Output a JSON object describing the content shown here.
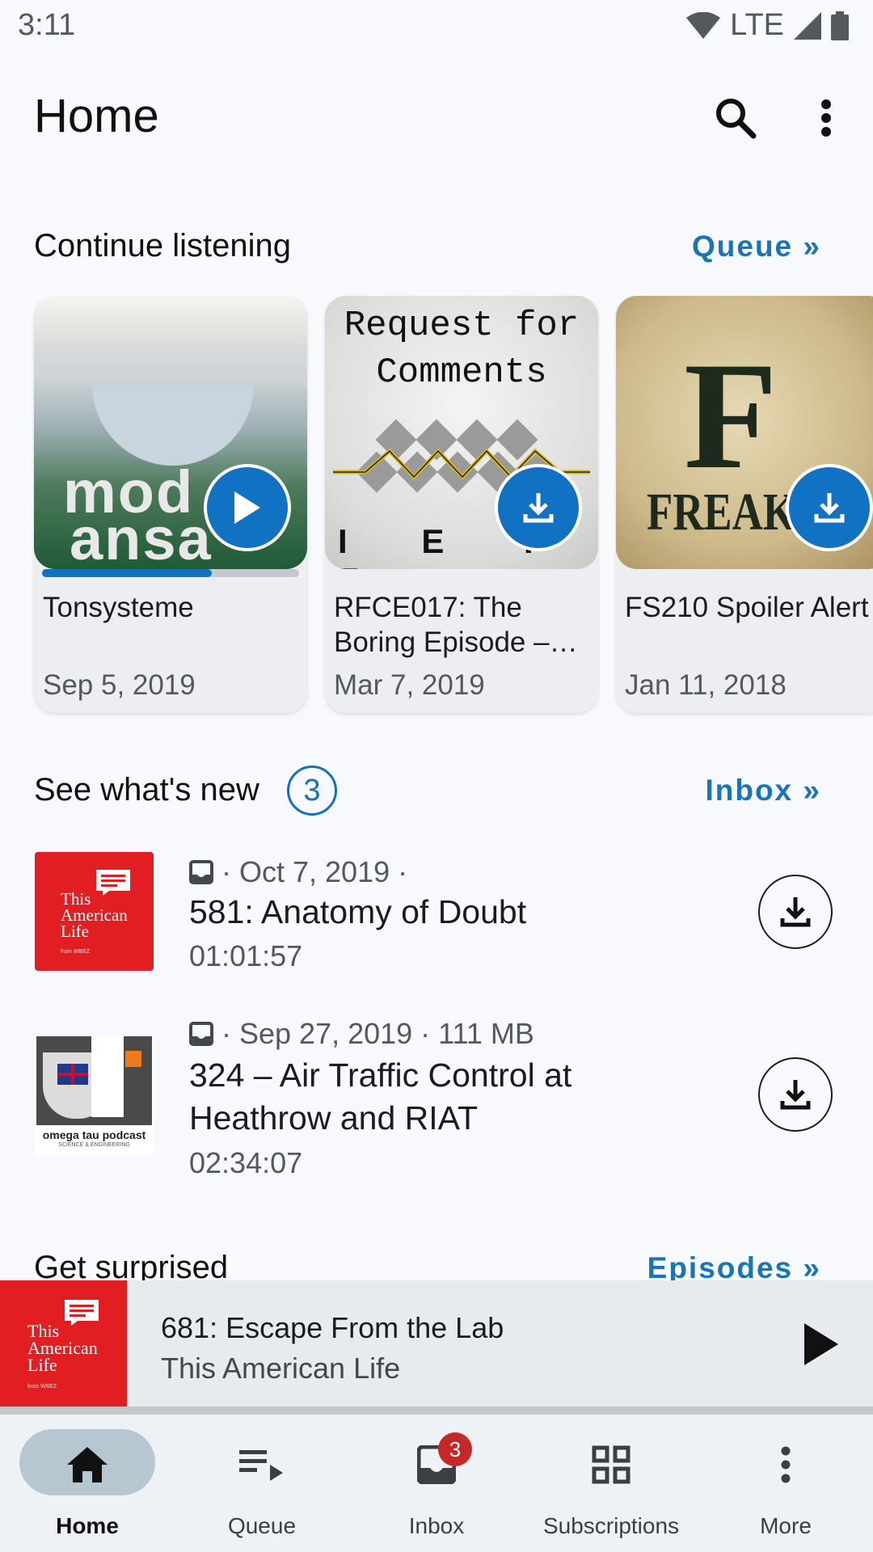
{
  "status_bar": {
    "time": "3:11",
    "network": "LTE"
  },
  "app_bar": {
    "title": "Home",
    "icons": [
      "search-icon",
      "more-vert-icon"
    ]
  },
  "continue_listening": {
    "title": "Continue listening",
    "link": "Queue »",
    "cards": [
      {
        "art_text_1": "mod",
        "art_text_2": "ansa",
        "title": "Tonsysteme",
        "date": "Sep 5, 2019",
        "action": "play-icon",
        "progress": 0.66
      },
      {
        "art_text_1": "Request for",
        "art_text_2": "Comments",
        "art_text_3": "I E T F",
        "title": "RFCE017: The Boring Episode –…",
        "date": "Mar 7, 2019",
        "action": "download-icon"
      },
      {
        "art_text_1": "F",
        "art_text_2": "FREAKS",
        "title": "FS210 Spoiler Alert",
        "date": "Jan 11, 2018",
        "action": "download-icon"
      }
    ]
  },
  "whats_new": {
    "title": "See what's new",
    "count": "3",
    "link": "Inbox »",
    "episodes": [
      {
        "logo_text": "This American Life",
        "logo_sub": "from WBEZ",
        "meta": "· Oct 7, 2019 ·",
        "title": "581: Anatomy of Doubt",
        "duration": "01:01:57"
      },
      {
        "logo_text": "omega tau podcast",
        "logo_sub": "SCIENCE & ENGINEERING",
        "meta": "· Sep 27, 2019 · 111 MB",
        "title": "324 – Air Traffic Control at Heathrow and RIAT",
        "duration": "02:34:07"
      }
    ]
  },
  "get_surprised": {
    "title": "Get surprised",
    "link": "Episodes »"
  },
  "mini_player": {
    "title": "681: Escape From the Lab",
    "podcast": "This American Life",
    "logo_text": "This American Life",
    "logo_sub": "from WBEZ"
  },
  "bottom_nav": {
    "items": [
      {
        "label": "Home",
        "icon": "home-icon",
        "active": true
      },
      {
        "label": "Queue",
        "icon": "queue-icon"
      },
      {
        "label": "Inbox",
        "icon": "inbox-icon",
        "badge": "3"
      },
      {
        "label": "Subscriptions",
        "icon": "grid-icon"
      },
      {
        "label": "More",
        "icon": "more-vert-icon"
      }
    ]
  },
  "colors": {
    "accent": "#1172c4",
    "link": "#1a74b8",
    "tal_red": "#e31e22",
    "badge": "#c62828"
  }
}
